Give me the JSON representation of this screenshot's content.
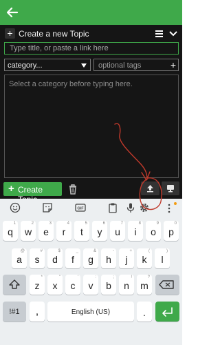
{
  "app_bar": {
    "back_icon": "arrow-left-icon",
    "color": "#3fa94a"
  },
  "composer": {
    "header_title": "Create a new Topic",
    "title_placeholder": "Type title, or paste a link here",
    "category_value": "category...",
    "tags_placeholder": "optional tags",
    "body_placeholder": "Select a category before typing here.",
    "create_button": "Create Topic",
    "icons": [
      "plus-icon",
      "menu-icon",
      "chevron-down-icon",
      "caret-down-icon",
      "trash-icon",
      "upload-icon",
      "preview-icon"
    ]
  },
  "keyboard": {
    "toolbar_icons": [
      "emoji-icon",
      "sticker-icon",
      "gif-icon",
      "clipboard-icon",
      "microphone-icon",
      "settings-icon",
      "more-icon"
    ],
    "gif_label": "GIF",
    "row1": {
      "keys": [
        "q",
        "w",
        "e",
        "r",
        "t",
        "y",
        "u",
        "i",
        "o",
        "p"
      ],
      "hints": [
        "1",
        "2",
        "3",
        "4",
        "5",
        "6",
        "7",
        "8",
        "9",
        "0"
      ]
    },
    "row2": {
      "keys": [
        "a",
        "s",
        "d",
        "f",
        "g",
        "h",
        "j",
        "k",
        "l"
      ],
      "hints": [
        "@",
        "#",
        "$",
        "_",
        "&",
        "-",
        "+",
        "(",
        ")"
      ]
    },
    "row3": {
      "keys": [
        "z",
        "x",
        "c",
        "v",
        "b",
        "n",
        "m"
      ],
      "hints": [
        "*",
        "\"",
        "'",
        ":",
        ";",
        "!",
        "?"
      ]
    },
    "symbols_key": "!#1",
    "comma_key": ",",
    "space_label": "English (US)",
    "period_key": "."
  },
  "annotation": {
    "color": "#c0392b"
  }
}
